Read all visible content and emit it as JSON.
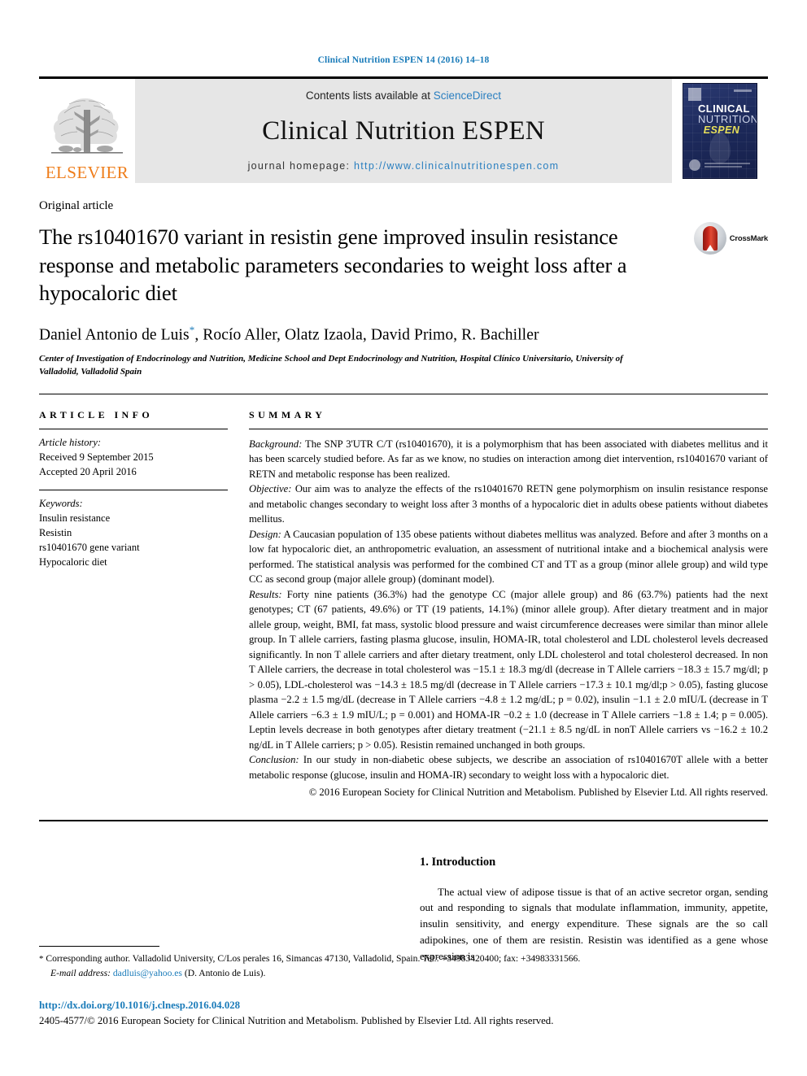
{
  "running_head": "Clinical Nutrition ESPEN 14 (2016) 14–18",
  "masthead": {
    "publisher_logo_text": "ELSEVIER",
    "contents_prefix": "Contents lists available at",
    "sciencedirect_link": "ScienceDirect",
    "journal_title": "Clinical Nutrition ESPEN",
    "homepage_prefix": "journal homepage:",
    "homepage_url": "http://www.clinicalnutritionespen.com",
    "cover": {
      "line1": "CLINICAL",
      "line2": "NUTRITION",
      "line3": "ESPEN"
    },
    "colors": {
      "link_blue": "#2a7fc0",
      "elsevier_orange": "#ef7d1a",
      "band_gray": "#e6e6e6",
      "cover_navy": "#1d2a5c"
    }
  },
  "article": {
    "type": "Original article",
    "title": "The rs10401670 variant in resistin gene improved insulin resistance response and metabolic parameters secondaries to weight loss after a hypocaloric diet",
    "crossmark_label": "CrossMark",
    "authors": "Daniel Antonio de Luis",
    "authors_rest": ", Rocío Aller, Olatz Izaola, David Primo, R. Bachiller",
    "corresponding_marker": "*",
    "affiliation": "Center of Investigation of Endocrinology and Nutrition, Medicine School and Dept Endocrinology and Nutrition, Hospital Clínico Universitario, University of Valladolid, Valladolid Spain"
  },
  "article_info": {
    "heading": "ARTICLE INFO",
    "history_label": "Article history:",
    "received": "Received 9 September 2015",
    "accepted": "Accepted 20 April 2016",
    "keywords_label": "Keywords:",
    "keywords": [
      "Insulin resistance",
      "Resistin",
      "rs10401670 gene variant",
      "Hypocaloric diet"
    ]
  },
  "summary": {
    "heading": "SUMMARY",
    "background_label": "Background:",
    "background_text": " The SNP 3'UTR C/T (rs10401670), it is a polymorphism that has been associated with diabetes mellitus and it has been scarcely studied before. As far as we know, no studies on interaction among diet intervention, rs10401670 variant of RETN and metabolic response has been realized.",
    "objective_label": "Objective:",
    "objective_text": " Our aim was to analyze the effects of the rs10401670 RETN gene polymorphism on insulin resistance response and metabolic changes secondary to weight loss after 3 months of a hypocaloric diet in adults obese patients without diabetes mellitus.",
    "design_label": "Design:",
    "design_text": " A Caucasian population of 135 obese patients without diabetes mellitus was analyzed. Before and after 3 months on a low fat hypocaloric diet, an anthropometric evaluation, an assessment of nutritional intake and a biochemical analysis were performed. The statistical analysis was performed for the combined CT and TT as a group (minor allele group) and wild type CC as second group (major allele group) (dominant model).",
    "results_label": "Results:",
    "results_text": " Forty nine patients (36.3%) had the genotype CC (major allele group) and 86 (63.7%) patients had the next genotypes; CT (67 patients, 49.6%) or TT (19 patients, 14.1%) (minor allele group). After dietary treatment and in major allele group, weight, BMI, fat mass, systolic blood pressure and waist circumference decreases were similar than minor allele group. In T allele carriers, fasting plasma glucose, insulin, HOMA-IR, total cholesterol and LDL cholesterol levels decreased significantly. In non T allele carriers and after dietary treatment, only LDL cholesterol and total cholesterol decreased. In non T Allele carriers, the decrease in total cholesterol was −15.1 ± 18.3 mg/dl (decrease in T Allele carriers −18.3 ± 15.7 mg/dl; p > 0.05), LDL-cholesterol was −14.3 ± 18.5 mg/dl (decrease in T Allele carriers −17.3 ± 10.1 mg/dl;p > 0.05), fasting glucose plasma −2.2 ± 1.5 mg/dL (decrease in T Allele carriers −4.8 ± 1.2 mg/dL; p = 0.02), insulin −1.1 ± 2.0 mIU/L (decrease in T Allele carriers −6.3 ± 1.9 mIU/L; p = 0.001) and HOMA-IR −0.2 ± 1.0 (decrease in T Allele carriers −1.8 ± 1.4; p = 0.005). Leptin levels decrease in both genotypes after dietary treatment (−21.1 ± 8.5 ng/dL in nonT Allele carriers vs −16.2 ± 10.2 ng/dL in T Allele carriers; p > 0.05). Resistin remained unchanged in both groups.",
    "conclusion_label": "Conclusion:",
    "conclusion_text": " In our study in non-diabetic obese subjects, we describe an association of rs10401670T allele with a better metabolic response (glucose, insulin and HOMA-IR) secondary to weight loss with a hypocaloric diet.",
    "copyright": "© 2016 European Society for Clinical Nutrition and Metabolism. Published by Elsevier Ltd. All rights reserved."
  },
  "introduction": {
    "heading": "1. Introduction",
    "paragraph": "The actual view of adipose tissue is that of an active secretor organ, sending out and responding to signals that modulate inflammation, immunity, appetite, insulin sensitivity, and energy expenditure. These signals are the so call adipokines, one of them are resistin. Resistin was identified as a gene whose expression is"
  },
  "footnote": {
    "star": "*",
    "corresponding": " Corresponding author. Valladolid University, C/Los perales 16, Simancas 47130, Valladolid, Spain. Tel.: +34983420400; fax: +34983331566.",
    "email_label": "E-mail address:",
    "email": "dadluis@yahoo.es",
    "email_suffix": " (D. Antonio de Luis)."
  },
  "footer": {
    "doi": "http://dx.doi.org/10.1016/j.clnesp.2016.04.028",
    "issn_line": "2405-4577/© 2016 European Society for Clinical Nutrition and Metabolism. Published by Elsevier Ltd. All rights reserved."
  }
}
